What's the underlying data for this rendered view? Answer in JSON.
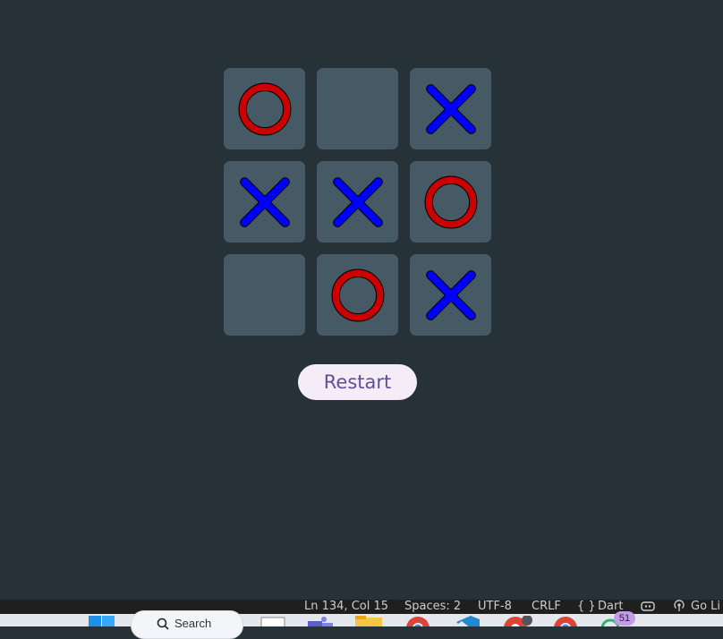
{
  "board": {
    "cells": [
      {
        "mark": "O"
      },
      {
        "mark": ""
      },
      {
        "mark": "X"
      },
      {
        "mark": "X"
      },
      {
        "mark": "X"
      },
      {
        "mark": "O"
      },
      {
        "mark": ""
      },
      {
        "mark": "O"
      },
      {
        "mark": "X"
      }
    ]
  },
  "restart_label": "Restart",
  "status_bar": {
    "position": "Ln 134, Col 15",
    "spaces": "Spaces: 2",
    "encoding": "UTF-8",
    "line_ending": "CRLF",
    "language_icon": "{ }",
    "language": "Dart",
    "go_live": "Go Li"
  },
  "taskbar": {
    "search_placeholder": "Search",
    "badge_count": "51"
  },
  "colors": {
    "background": "#263238",
    "cell": "#455a64",
    "o_mark": "#cc0000",
    "x_mark": "#0000ff",
    "button_bg": "#f4edf7",
    "button_text": "#5f4f9a"
  }
}
